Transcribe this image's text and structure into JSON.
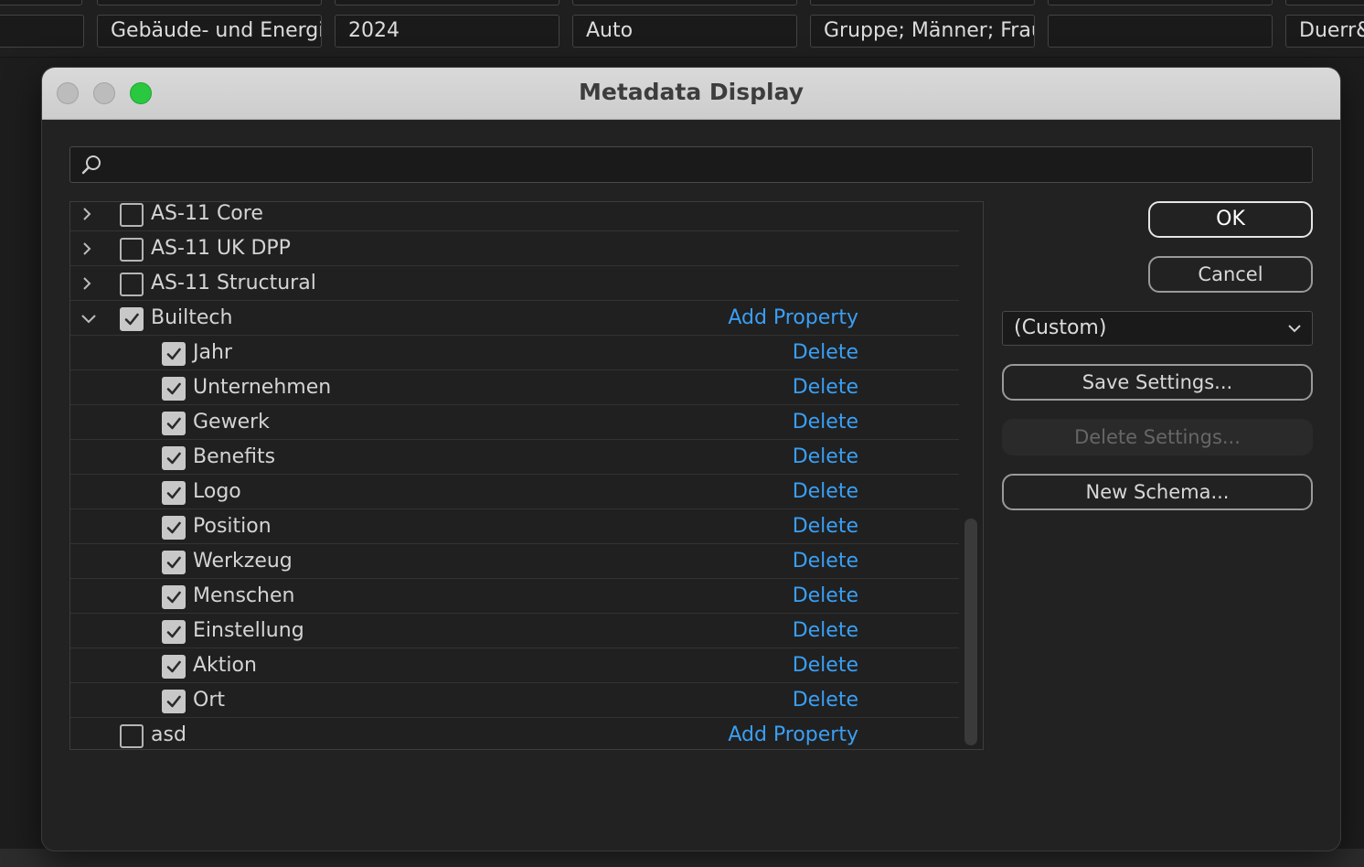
{
  "background": {
    "cells": [
      "",
      "Gebäude- und Energiet",
      "2024",
      "Auto",
      "Gruppe; Männer; Frau",
      "",
      "Duerr&"
    ]
  },
  "dialog": {
    "title": "Metadata Display",
    "search": {
      "value": "",
      "placeholder": ""
    },
    "tree": {
      "add_property_label": "Add Property",
      "delete_label": "Delete",
      "groups_before": [
        {
          "label": "AS-11 Core",
          "checked": false,
          "expanded": false
        },
        {
          "label": "AS-11 UK DPP",
          "checked": false,
          "expanded": false
        },
        {
          "label": "AS-11 Structural",
          "checked": false,
          "expanded": false
        }
      ],
      "builtech": {
        "label": "Builtech",
        "checked": true,
        "expanded": true,
        "properties": [
          "Jahr",
          "Unternehmen",
          "Gewerk",
          "Benefits",
          "Logo",
          "Position",
          "Werkzeug",
          "Menschen",
          "Einstellung",
          "Aktion",
          "Ort"
        ]
      },
      "groups_after": [
        {
          "label": "asd",
          "checked": false
        }
      ]
    },
    "buttons": {
      "ok": "OK",
      "cancel": "Cancel",
      "save_settings": "Save Settings...",
      "delete_settings": "Delete Settings...",
      "new_schema": "New Schema..."
    },
    "preset": {
      "selected": "(Custom)"
    }
  },
  "icons": {
    "search": "search-icon",
    "expand": "chevron-right-icon",
    "collapse": "chevron-down-icon",
    "check": "checkmark-icon",
    "dropdown": "chevron-down-icon"
  },
  "colors": {
    "link": "#3a9ff5",
    "zoom_button": "#2ac840",
    "titlebar": "#d3d3d3",
    "panel": "#222222"
  }
}
